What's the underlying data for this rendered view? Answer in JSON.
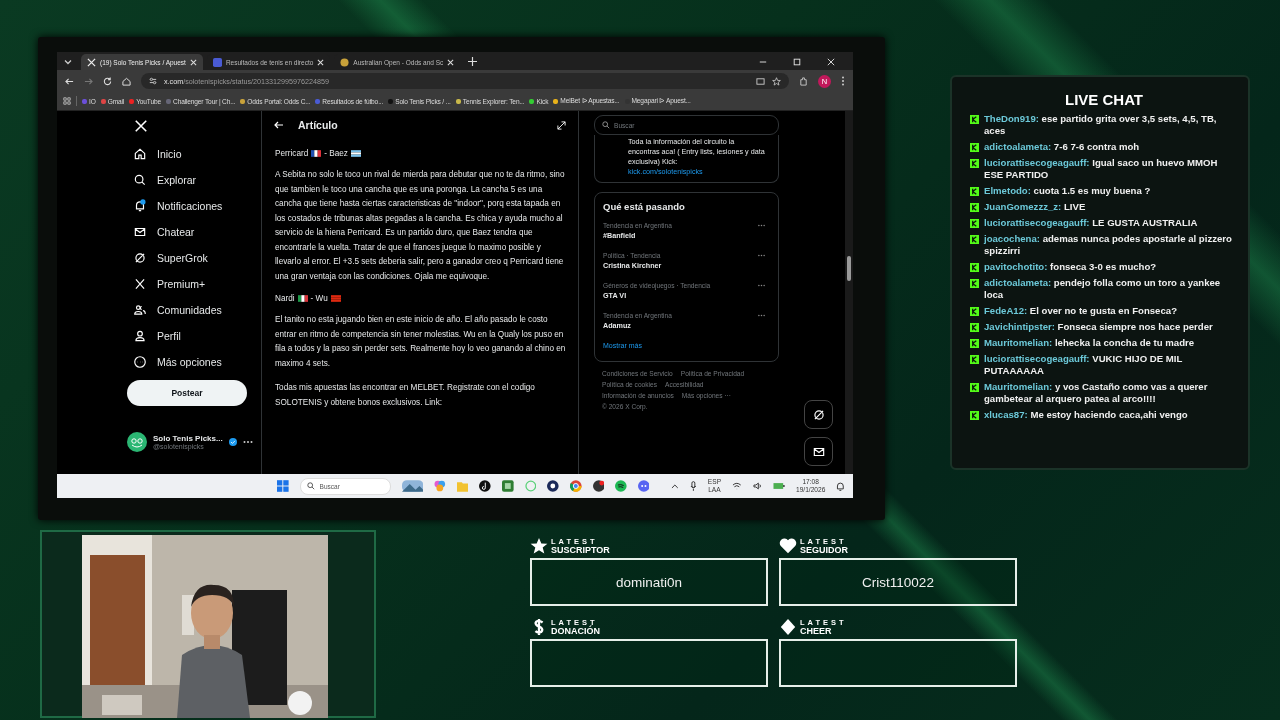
{
  "browser": {
    "tabs": [
      {
        "title": "(19) Solo Tenis Picks / Apuest",
        "selected": true
      },
      {
        "title": "Resultados de tenis en directo",
        "selected": false
      },
      {
        "title": "Australian Open - Odds and Sc",
        "selected": false
      }
    ],
    "url": {
      "host": "x.com",
      "path": "/solotenispicks/status/2013312995976224859"
    },
    "profile_initial": "N",
    "bookmarks": [
      "IO",
      "Gmail",
      "YouTube",
      "Challenger Tour | Ch...",
      "Odds Portal: Odds C...",
      "Resultados de fútbo...",
      "Solo Tenis Picks / ...",
      "Tennis Explorer: Ten...",
      "Kick",
      "MelBet ᐅ Apuestas...",
      "Megapari ᐅ Apuest..."
    ]
  },
  "nav": {
    "items": [
      "Inicio",
      "Explorar",
      "Notificaciones",
      "Chatear",
      "SuperGrok",
      "Premium+",
      "Comunidades",
      "Perfil",
      "Más opciones"
    ],
    "post_button": "Postear",
    "account": {
      "name": "Solo Tenis Picks...",
      "handle": "@solotenispicks"
    }
  },
  "article": {
    "header": "Artículo",
    "blocks": [
      {
        "kind": "match",
        "player1": "Perricard",
        "player2": "- Baez"
      },
      {
        "kind": "text",
        "text": "A Sebita no solo le toco un rival de mierda para debutar que no te da ritmo, sino que tambien le toco una cancha que es una poronga. La cancha 5 es una cancha que tiene hasta ciertas caracteristicas de \"indoor\", porq esta tapada en los costados de tribunas altas pegadas a la cancha. Es chica y ayuda mucho al servicio de la hiena Perricard. Es un partido duro, que Baez tendra que encontrarle la vuelta. Tratar de que el frances juegue lo maximo posible y llevarlo al error. El +3.5 sets deberia salir, pero a ganador creo q Perricard tiene una gran ventaja con las condiciones. Ojala me equivoque."
      },
      {
        "kind": "match",
        "player1": "Nardi",
        "player2": "- Wu"
      },
      {
        "kind": "text",
        "text": "El tanito no esta jugando bien en este inicio de año. El año pasado le costo entrar en ritmo de competencia sin tener molestias. Wu en la Qualy los puso en fila a todos y la paso sin perder sets. Realmente hoy lo veo ganando al chino en maximo 4 sets."
      },
      {
        "kind": "text",
        "text": "Todas mis apuestas las encontrar en MELBET. Registrate con el codigo SOLOTENIS y obtene bonos exclusivos. Link:"
      }
    ]
  },
  "sidebar": {
    "search": {
      "placeholder": "Buscar"
    },
    "bio": {
      "lines": [
        "Toda la información del circuito la",
        "encontras aca! ( Entry lists, lesiones y data exclusiva) Kick:"
      ],
      "link": "kick.com/solotenispicks"
    },
    "trends_title": "Qué está pasando",
    "trends": [
      {
        "context": "Tendencia en Argentina",
        "name": "#Banfield"
      },
      {
        "context": "Política · Tendencia",
        "name": "Cristina Kirchner"
      },
      {
        "context": "Géneros de videojuegos · Tendencia",
        "name": "GTA VI"
      },
      {
        "context": "Tendencia en Argentina",
        "name": "Adamuz"
      }
    ],
    "show_more": "Mostrar más",
    "footer_links": [
      "Condiciones de Servicio",
      "Política de Privacidad",
      "Política de cookies",
      "Accesibilidad",
      "Información de anuncios",
      "Más opciones ···"
    ],
    "copyright": "© 2026 X Corp."
  },
  "taskbar": {
    "search": {
      "placeholder": "Buscar"
    },
    "language": [
      "ESP",
      "LAA"
    ],
    "time": "17:08",
    "date": "19/1/2026"
  },
  "chat": {
    "title": "LIVE CHAT",
    "messages": [
      {
        "user": "TheDon919:",
        "text": "ese partido grita over 3,5 sets, 4,5, TB, aces"
      },
      {
        "user": "adictoalameta:",
        "text": "7-6 7-6 contra moh"
      },
      {
        "user": "luciorattisecogeagauff:",
        "text": "Igual saco un huevo MMOH ESE PARTIDO"
      },
      {
        "user": "Elmetodo:",
        "text": "cuota 1.5 es muy buena ?"
      },
      {
        "user": "JuanGomezzz_z:",
        "text": "LIVE"
      },
      {
        "user": "luciorattisecogeagauff:",
        "text": "LE GUSTA AUSTRALIA"
      },
      {
        "user": "joacochena:",
        "text": "ademas nunca podes apostarle al pizzero spizzirri"
      },
      {
        "user": "pavitochotito:",
        "text": "fonseca 3-0 es mucho?"
      },
      {
        "user": "adictoalameta:",
        "text": "pendejo folla como un toro a yankee loca"
      },
      {
        "user": "FedeA12:",
        "text": "El over no te gusta en Fonseca?"
      },
      {
        "user": "Javichintipster:",
        "text": "Fonseca siempre nos hace perder"
      },
      {
        "user": "Mauritomelian:",
        "text": "lehecka la concha de tu madre"
      },
      {
        "user": "luciorattisecogeagauff:",
        "text": "VUKIC HIJO DE MIL PUTAAAAAA"
      },
      {
        "user": "Mauritomelian:",
        "text": "y vos Castaño como vas a querer gambetear al arquero patea al arco!!!!"
      },
      {
        "user": "xlucas87:",
        "text": "Me estoy haciendo caca,ahi vengo"
      }
    ]
  },
  "alerts": [
    {
      "kind": "star",
      "latest": "LATEST",
      "label": "SUSCRIPTOR",
      "value": "dominati0n"
    },
    {
      "kind": "heart",
      "latest": "LATEST",
      "label": "SEGUIDOR",
      "value": "Crist110022"
    },
    {
      "kind": "dollar",
      "latest": "LATEST",
      "label": "DONACIÓN"
    },
    {
      "kind": "diamond",
      "latest": "LATEST",
      "label": "CHEER"
    }
  ]
}
